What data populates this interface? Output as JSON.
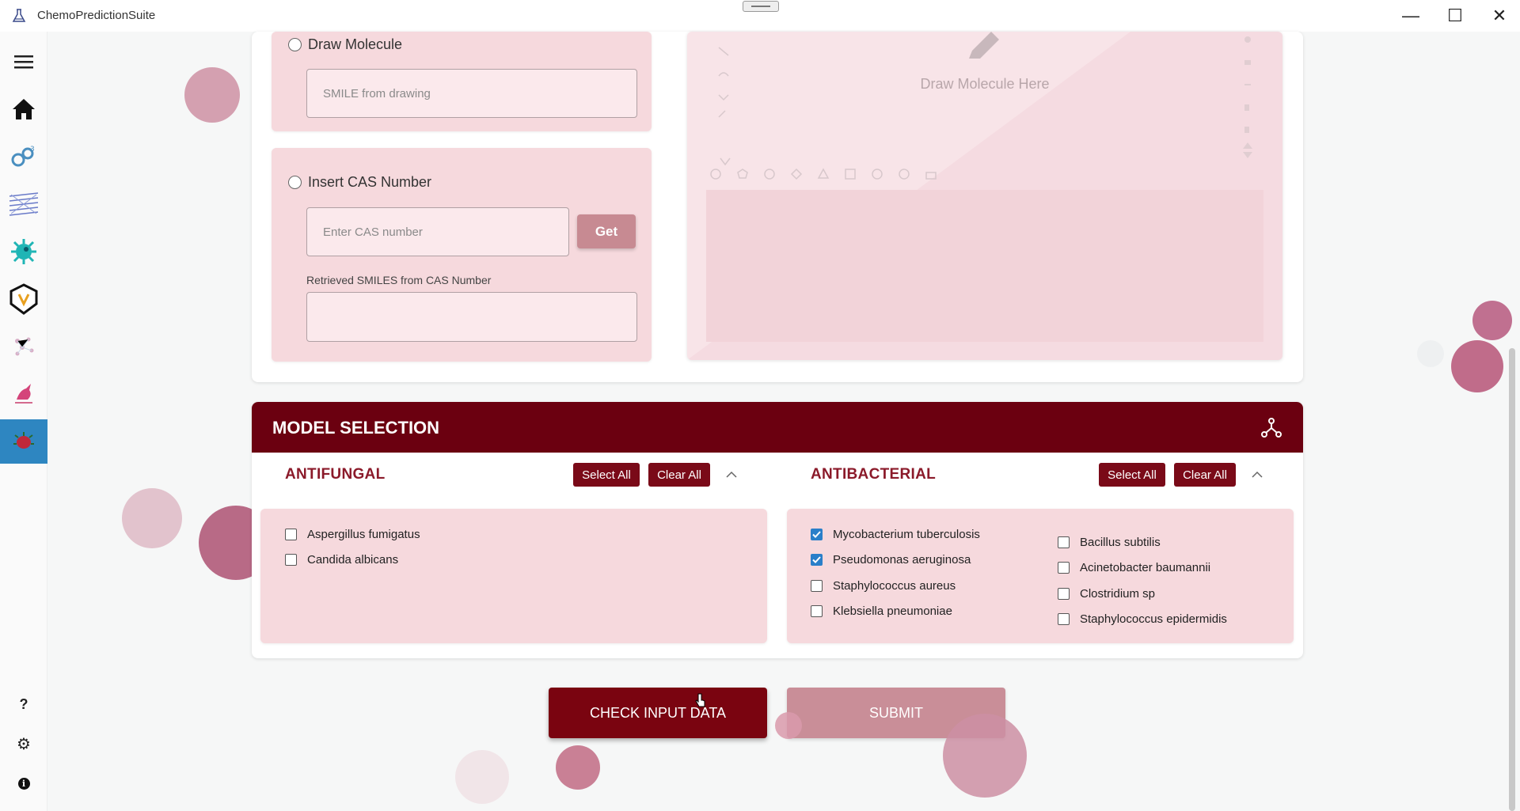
{
  "window": {
    "title": "ChemoPredictionSuite",
    "controls": {
      "minimize": "—",
      "maximize": "☐",
      "close": "✕"
    }
  },
  "sidebar": {
    "items": [
      {
        "icon": "menu-icon"
      },
      {
        "icon": "home-icon"
      },
      {
        "icon": "molecule-3d-icon"
      },
      {
        "icon": "layers-icon"
      },
      {
        "icon": "virus-icon"
      },
      {
        "icon": "shield-app-icon"
      },
      {
        "icon": "network-icon"
      },
      {
        "icon": "unicorn-icon"
      },
      {
        "icon": "bacteria-icon",
        "active": true
      }
    ],
    "bottom": [
      {
        "icon": "help-icon",
        "glyph": "?"
      },
      {
        "icon": "gear-icon",
        "glyph": "⚙"
      },
      {
        "icon": "info-icon",
        "glyph": "i"
      }
    ]
  },
  "input": {
    "draw_molecule_label": "Draw Molecule",
    "smile_placeholder": "SMILE from drawing",
    "cas_label": "Insert CAS Number",
    "cas_placeholder": "Enter CAS number",
    "get_label": "Get",
    "retrieved_label": "Retrieved SMILES from CAS Number",
    "retrieved_value": ""
  },
  "drawer": {
    "hint": "Draw Molecule Here"
  },
  "model_selection": {
    "title": "MODEL SELECTION",
    "antifungal": {
      "title": "ANTIFUNGAL",
      "select_all": "Select All",
      "clear_all": "Clear All",
      "items": [
        {
          "label": "Aspergillus fumigatus",
          "checked": false
        },
        {
          "label": "Candida albicans",
          "checked": false
        }
      ]
    },
    "antibacterial": {
      "title": "ANTIBACTERIAL",
      "select_all": "Select All",
      "clear_all": "Clear All",
      "col1": [
        {
          "label": "Mycobacterium tuberculosis",
          "checked": true
        },
        {
          "label": "Pseudomonas aeruginosa",
          "checked": true
        },
        {
          "label": "Staphylococcus aureus",
          "checked": false
        },
        {
          "label": "Klebsiella pneumoniae",
          "checked": false
        }
      ],
      "col2": [
        {
          "label": "Bacillus subtilis",
          "checked": false
        },
        {
          "label": "Acinetobacter baumannii",
          "checked": false
        },
        {
          "label": "Clostridium sp",
          "checked": false
        },
        {
          "label": "Staphylococcus epidermidis",
          "checked": false
        }
      ]
    }
  },
  "actions": {
    "check_input": "CHECK INPUT DATA",
    "submit": "SUBMIT"
  },
  "colors": {
    "primary": "#6b0010",
    "accent_bubble": "#b5607a",
    "panel": "#f6d9dd"
  }
}
